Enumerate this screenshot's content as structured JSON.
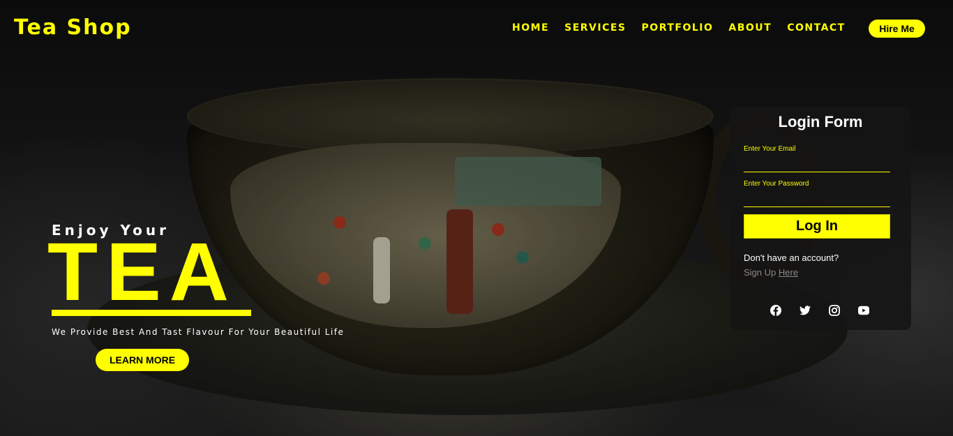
{
  "header": {
    "logo": "Tea Shop",
    "nav": [
      "HOME",
      "SERVICES",
      "PORTFOLIO",
      "ABOUT",
      "CONTACT"
    ],
    "hire_button": "Hire Me"
  },
  "hero": {
    "subtitle": "Enjoy Your",
    "title": "TEA",
    "description": "We Provide Best And Tast Flavour For Your Beautiful Life",
    "cta": "LEARN MORE"
  },
  "login": {
    "title": "Login Form",
    "email_label": "Enter Your Email",
    "password_label": "Enter Your Password",
    "button": "Log In",
    "no_account": "Don't have an account?",
    "signup_prefix": "Sign Up",
    "signup_link": "Here"
  },
  "social_icons": [
    "facebook-icon",
    "twitter-icon",
    "instagram-icon",
    "youtube-icon"
  ],
  "colors": {
    "accent": "#ffff00",
    "background": "#0b0b0b",
    "card": "#141414"
  }
}
